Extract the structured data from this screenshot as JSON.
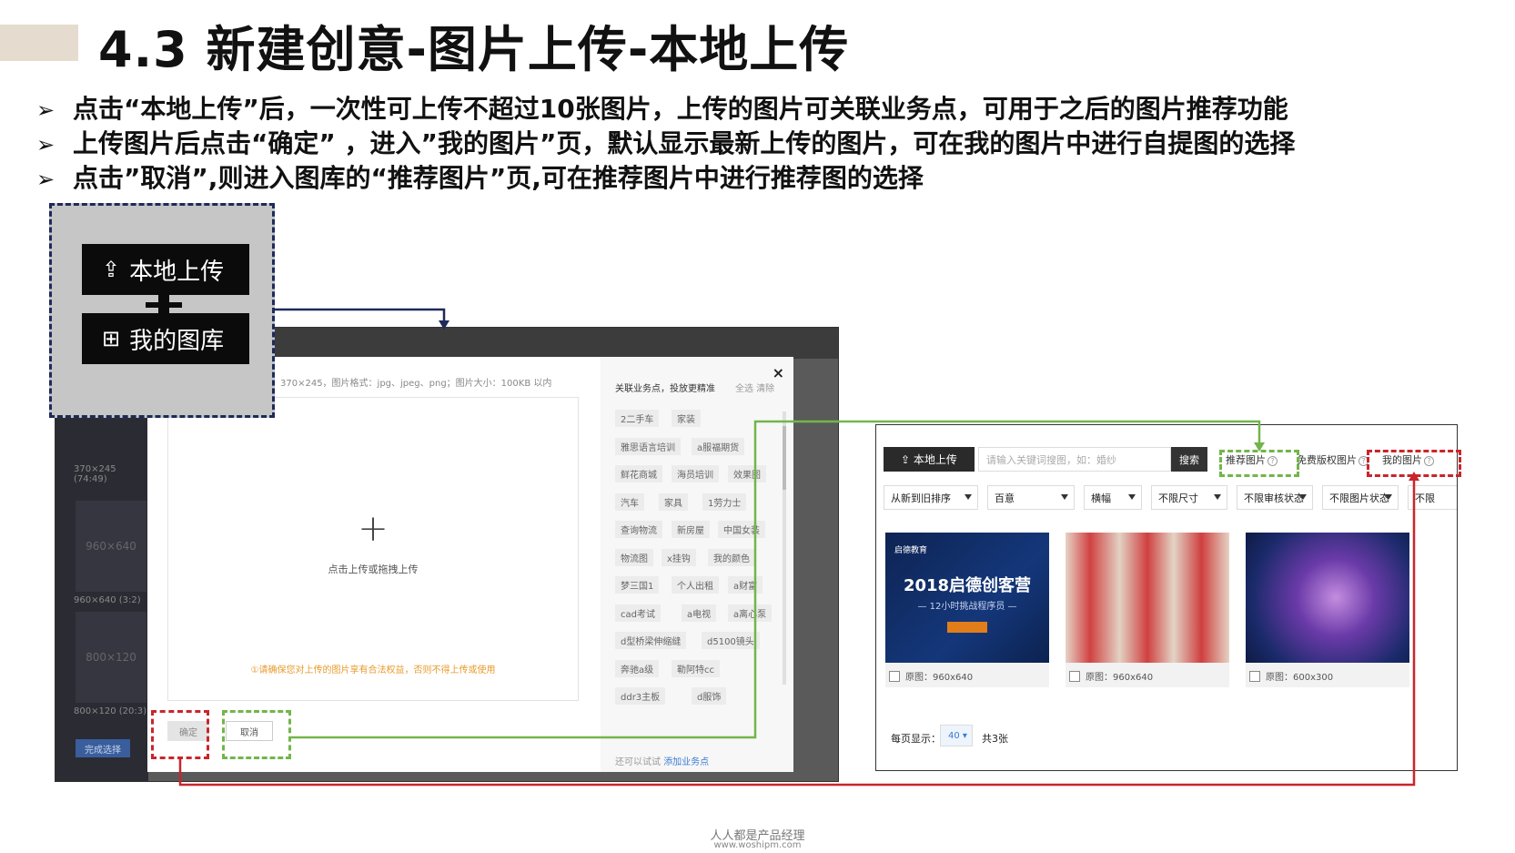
{
  "slide": {
    "title": "4.3 新建创意-图片上传-本地上传",
    "bullets": [
      "点击“本地上传”后，一次性可上传不超过10张图片，上传的图片可关联业务点，可用于之后的图片推荐功能",
      "上传图片后点击“确定” ，进入”我的图片”页，默认显示最新上传的图片，可在我的图片中进行自提图的选择",
      "点击”取消”,则进入图库的“推荐图片”页,可在推荐图片中进行推荐图的选择"
    ],
    "bullet_glyph": "➢",
    "accent_color": "#e5dccf"
  },
  "callout": {
    "local_upload": "本地上传",
    "my_library": "我的图库",
    "border_color": "#1e2a5a"
  },
  "left_shot": {
    "thumbs": [
      {
        "label": "960×640",
        "caption": "960×640 (3:2)"
      },
      {
        "label": "800×120",
        "caption": "800×120 (20:3)"
      }
    ],
    "first_caption": "370×245 (74:49)",
    "done_button": "完成选择",
    "modal": {
      "info": "370×245，图片格式：jpg、jpeg、png；图片大小：100KB 以内",
      "plus": "+",
      "upload_label": "点击上传或拖拽上传",
      "warning": "①请确保您对上传的图片享有合法权益，否则不得上传或使用",
      "ok": "确定",
      "cancel": "取消",
      "close": "×",
      "biz_title": "关联业务点，投放更精准",
      "select_all": "全选  清除",
      "tags": [
        [
          "2二手车",
          "家装"
        ],
        [
          "雅思语言培训",
          "a服福期货"
        ],
        [
          "鲜花商城",
          "海员培训",
          "效果图"
        ],
        [
          "汽车",
          "家具",
          "1劳力士"
        ],
        [
          "查询物流",
          "新房屋",
          "中国女装"
        ],
        [
          "物流图",
          "x挂钩",
          "我的颜色"
        ],
        [
          "梦三国1",
          "个人出租",
          "a财富"
        ],
        [
          "cad考试",
          "a电视",
          "a离心泵"
        ],
        [
          "d型桥梁伸缩缝",
          "d5100镜头"
        ],
        [
          "奔驰a级",
          "勒阿特cc"
        ],
        [
          "ddr3主板",
          "d服饰"
        ]
      ],
      "footer_text": "还可以试试",
      "footer_link": "添加业务点"
    }
  },
  "right_shot": {
    "upload": "本地上传",
    "search_placeholder": "请输入关键词搜图，如：婚纱",
    "search_button": "搜索",
    "tab_recommended": "推荐图片",
    "tab_free": "免费版权图片",
    "tab_mine": "我的图片",
    "selects": [
      "从新到旧排序",
      "百意",
      "横幅",
      "不限尺寸",
      "不限审核状态",
      "不限图片状态",
      "不限"
    ],
    "cards": [
      {
        "meta": "原图：960x640",
        "heading": "2018启德创客营",
        "sub": "— 12小时挑战程序员 —",
        "logo": "启德教育"
      },
      {
        "meta": "原图：960x640"
      },
      {
        "meta": "原图：600x300"
      }
    ],
    "per_page_label": "每页显示：",
    "per_page_value": "40",
    "total": "共3张"
  },
  "watermark": {
    "line1": "人人都是产品经理",
    "line2": "www.woshipm.com"
  },
  "colors": {
    "connector_blue": "#1e2a5a",
    "connector_green": "#73b54a",
    "connector_red": "#c9252c"
  }
}
